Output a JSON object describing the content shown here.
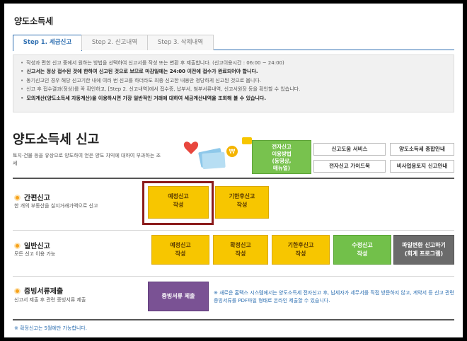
{
  "page_title": "양도소득세",
  "tabs": [
    {
      "label": "Step 1. 세금신고"
    },
    {
      "label": "Step 2. 신고내역"
    },
    {
      "label": "Step 3. 삭제내역"
    }
  ],
  "notice": [
    "작성과 편한 신고 중에서 원하는 방법을 선택하여 신고서를 작성 또는 변환 후 제출합니다. (신고이용시간 : 06:00 ~ 24:00)",
    "신고서는 정상 접수된 것에 한하여 신고된 것으로 보므로 마감일에는 24:00 이전에 접수가 완료되어야 합니다.",
    "동기신고인 경우 해당 신고기한 내에 여러 번 신고를 하더라도 최종 신고한 내용만 정당하게 신고된 것으로 봅니다.",
    "신고 후 접수결과(정상)를 꼭 확인하고, [Step 2. 신고내역]에서 접수증, 납부서, 첨부서류내역, 신고서원장 등을 확인할 수 있습니다.",
    "모의계산(양도소득세 자동계산)을 이용하시면 가장 일반적인 거래에 대하여 세금계산내역을 조회해 볼 수 있습니다."
  ],
  "main_title": "양도소득세 신고",
  "main_desc": "토지·건물 등을 유상으로 양도하여 얻은 양도 차익에 대하여 부과하는 조세",
  "guide": {
    "line1": "전자신고",
    "line2": "이용방법",
    "line3": "(동영상,",
    "line4": "매뉴얼)"
  },
  "links": {
    "help": "신고도움 서비스",
    "overview": "양도소득세 종합안내",
    "guidebook": "전자신고 가이드북",
    "nonbiz": "비사업용토지 신고안내"
  },
  "simple": {
    "title": "간편신고",
    "desc": "한 개의 부동산을 실지거래가액으로 신고",
    "btn1": [
      "예정신고",
      "작성"
    ],
    "btn2": [
      "기한후신고",
      "작성"
    ]
  },
  "general": {
    "title": "일반신고",
    "desc": "모든 신고 이용 가능",
    "btn1": [
      "예정신고",
      "작성"
    ],
    "btn2": [
      "확정신고",
      "작성"
    ],
    "btn3": [
      "기한후신고",
      "작성"
    ],
    "btn4": [
      "수정신고",
      "작성"
    ],
    "btn5": [
      "파일변환 신고하기",
      "(회계 프로그램)"
    ]
  },
  "proof": {
    "title": "증빙서류제출",
    "desc": "신고서 제출 후 관련 증빙서류 제출",
    "btn": "증빙서류 제출",
    "note": "※ 새로운 홈택스 시스템에서는 양도소득세 전자신고 후, 납세자가 세무서를 직접 방문하지 않고, 계약서 등 신고 관련 증빙서류를 PDF파일 형태로 온라인 제출할 수 있습니다."
  },
  "footer_note": "※ 확정신고는 5월에만 가능합니다.",
  "colors": {
    "accent": "#2f6fb1",
    "yellow": "#f7c600",
    "green": "#72c04a",
    "purple": "#7a5294",
    "highlight": "#8b1b1b"
  }
}
